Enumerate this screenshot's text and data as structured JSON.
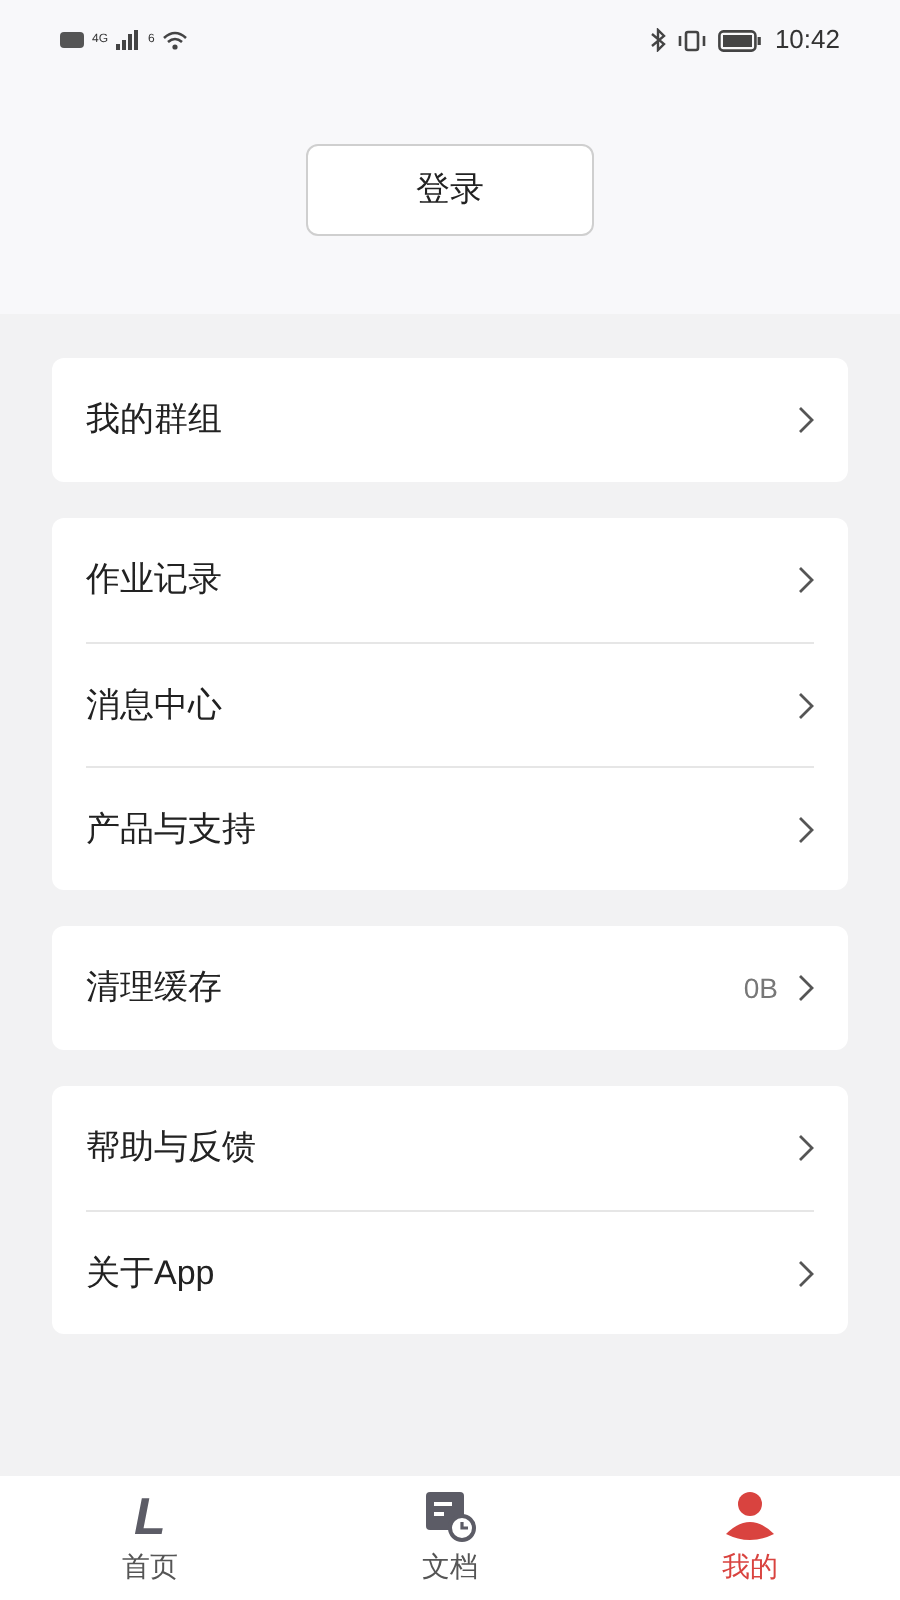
{
  "status_bar": {
    "network": "4G",
    "wifi_badge": "6",
    "time": "10:42"
  },
  "login_button": "登录",
  "groups": [
    {
      "items": [
        {
          "label": "我的群组"
        }
      ]
    },
    {
      "items": [
        {
          "label": "作业记录"
        },
        {
          "label": "消息中心"
        },
        {
          "label": "产品与支持"
        }
      ]
    },
    {
      "items": [
        {
          "label": "清理缓存",
          "value": "0B"
        }
      ]
    },
    {
      "items": [
        {
          "label": "帮助与反馈"
        },
        {
          "label": "关于App"
        }
      ]
    }
  ],
  "tab_bar": [
    {
      "kind": "home",
      "label": "首页",
      "logo_text": "L",
      "selected": false
    },
    {
      "kind": "docs",
      "label": "文档",
      "selected": false
    },
    {
      "kind": "me",
      "label": "我的",
      "selected": true
    }
  ]
}
